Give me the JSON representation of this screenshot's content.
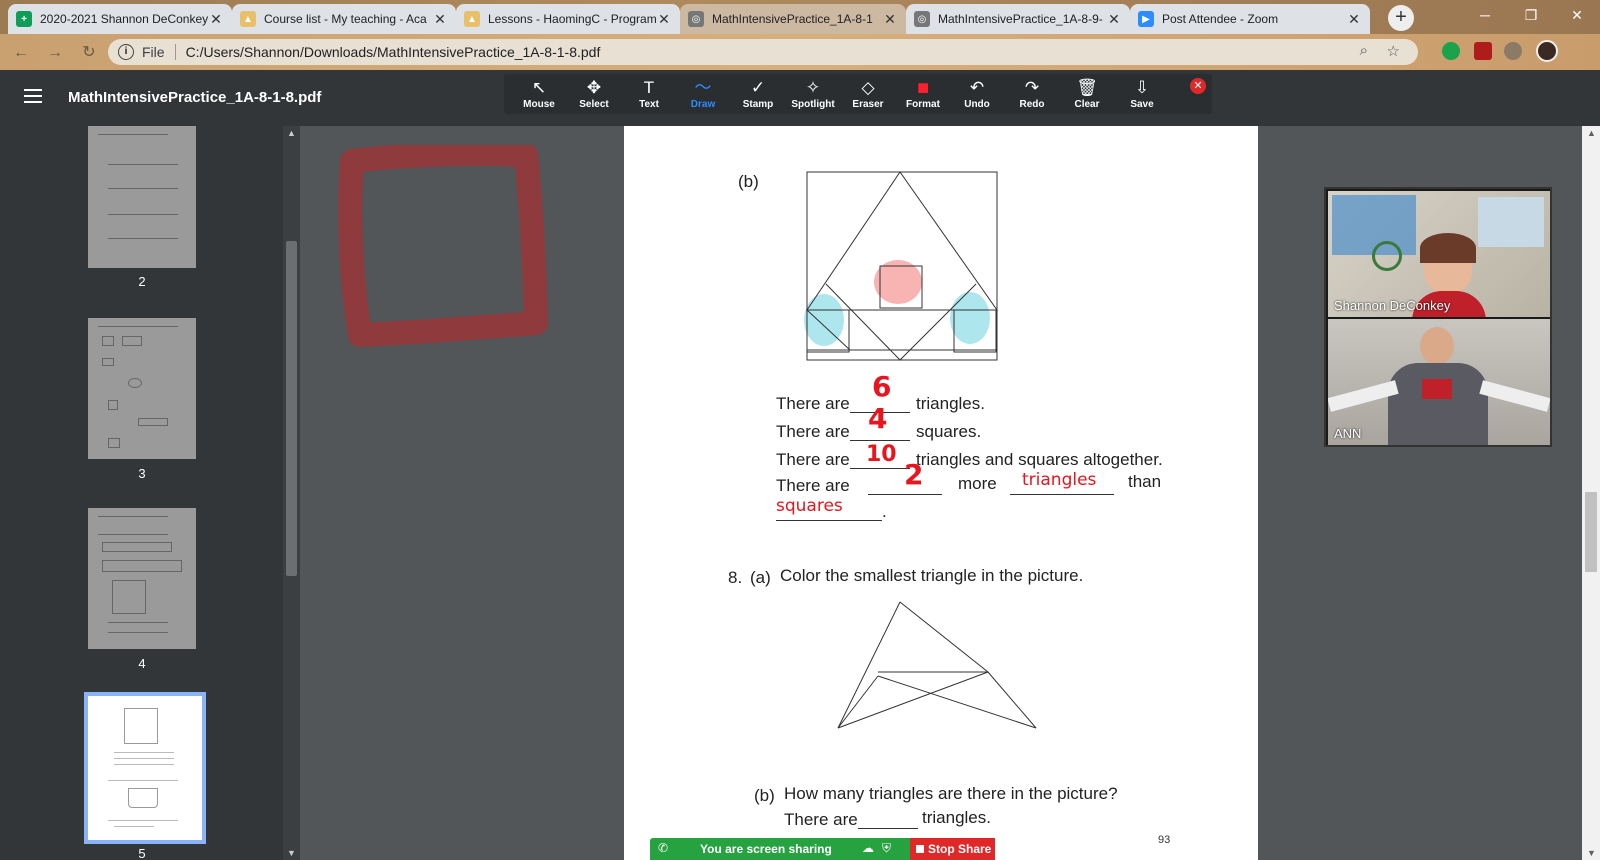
{
  "tabs": [
    {
      "title": "2020-2021 Shannon DeConkey",
      "favicon": "sheets-icon",
      "color": "#0f9d58"
    },
    {
      "title": "Course list - My teaching - Aca",
      "favicon": "class-icon",
      "color": "#e8c06a"
    },
    {
      "title": "Lessons - HaomingC - Program",
      "favicon": "class-icon",
      "color": "#e8c06a"
    },
    {
      "title": "MathIntensivePractice_1A-8-1",
      "favicon": "globe-icon",
      "color": "#666666"
    },
    {
      "title": "MathIntensivePractice_1A-8-9-",
      "favicon": "globe-icon",
      "color": "#666666"
    },
    {
      "title": "Post Attendee - Zoom",
      "favicon": "zoom-icon",
      "color": "#2d8cff"
    }
  ],
  "address": {
    "scheme_label": "File",
    "url": "C:/Users/Shannon/Downloads/MathIntensivePractice_1A-8-1-8.pdf"
  },
  "viewer": {
    "filename": "MathIntensivePractice_1A-8-1-8.pdf"
  },
  "annotate_tools": [
    {
      "id": "mouse",
      "label": "Mouse",
      "glyph": "↖"
    },
    {
      "id": "select",
      "label": "Select",
      "glyph": "✥"
    },
    {
      "id": "text",
      "label": "Text",
      "glyph": "T"
    },
    {
      "id": "draw",
      "label": "Draw",
      "glyph": "〜"
    },
    {
      "id": "stamp",
      "label": "Stamp",
      "glyph": "✓"
    },
    {
      "id": "spotlight",
      "label": "Spotlight",
      "glyph": "✧"
    },
    {
      "id": "eraser",
      "label": "Eraser",
      "glyph": "◇"
    },
    {
      "id": "format",
      "label": "Format",
      "glyph": "■"
    },
    {
      "id": "undo",
      "label": "Undo",
      "glyph": "↶"
    },
    {
      "id": "redo",
      "label": "Redo",
      "glyph": "↷"
    },
    {
      "id": "clear",
      "label": "Clear",
      "glyph": "🗑"
    },
    {
      "id": "save",
      "label": "Save",
      "glyph": "⇩"
    }
  ],
  "active_tool": "Draw",
  "format_color": "#ff1f2d",
  "thumbnails": [
    {
      "number": "2",
      "selected": false
    },
    {
      "number": "3",
      "selected": false
    },
    {
      "number": "4",
      "selected": false
    },
    {
      "number": "5",
      "selected": true
    }
  ],
  "worksheet": {
    "part_b_label": "(b)",
    "lines": [
      {
        "prefix": "There are",
        "suffix": "triangles.",
        "answer": "6"
      },
      {
        "prefix": "There are",
        "suffix": "squares.",
        "answer": "4"
      },
      {
        "prefix": "There are",
        "suffix": "triangles and squares altogether.",
        "answer": "10"
      }
    ],
    "more_line": {
      "prefix": "There  are",
      "answer": "2",
      "more_word": "more",
      "answer2": "triangles",
      "than_word": "than",
      "answer3": "squares",
      "period": "."
    },
    "q8_number": "8.",
    "q8a_label": "(a)",
    "q8a_text": "Color the smallest triangle in the picture.",
    "q8b_label": "(b)",
    "q8b_text": "How many triangles are there in the picture?",
    "q8b_line_prefix": "There are",
    "q8b_line_suffix": "triangles.",
    "page_number": "93"
  },
  "annotation_color": "#e8141e",
  "participants": [
    {
      "name": "Shannon DeConkey"
    },
    {
      "name": "ANN"
    }
  ],
  "sharing": {
    "status": "You are screen sharing",
    "stop_label": "Stop Share"
  }
}
